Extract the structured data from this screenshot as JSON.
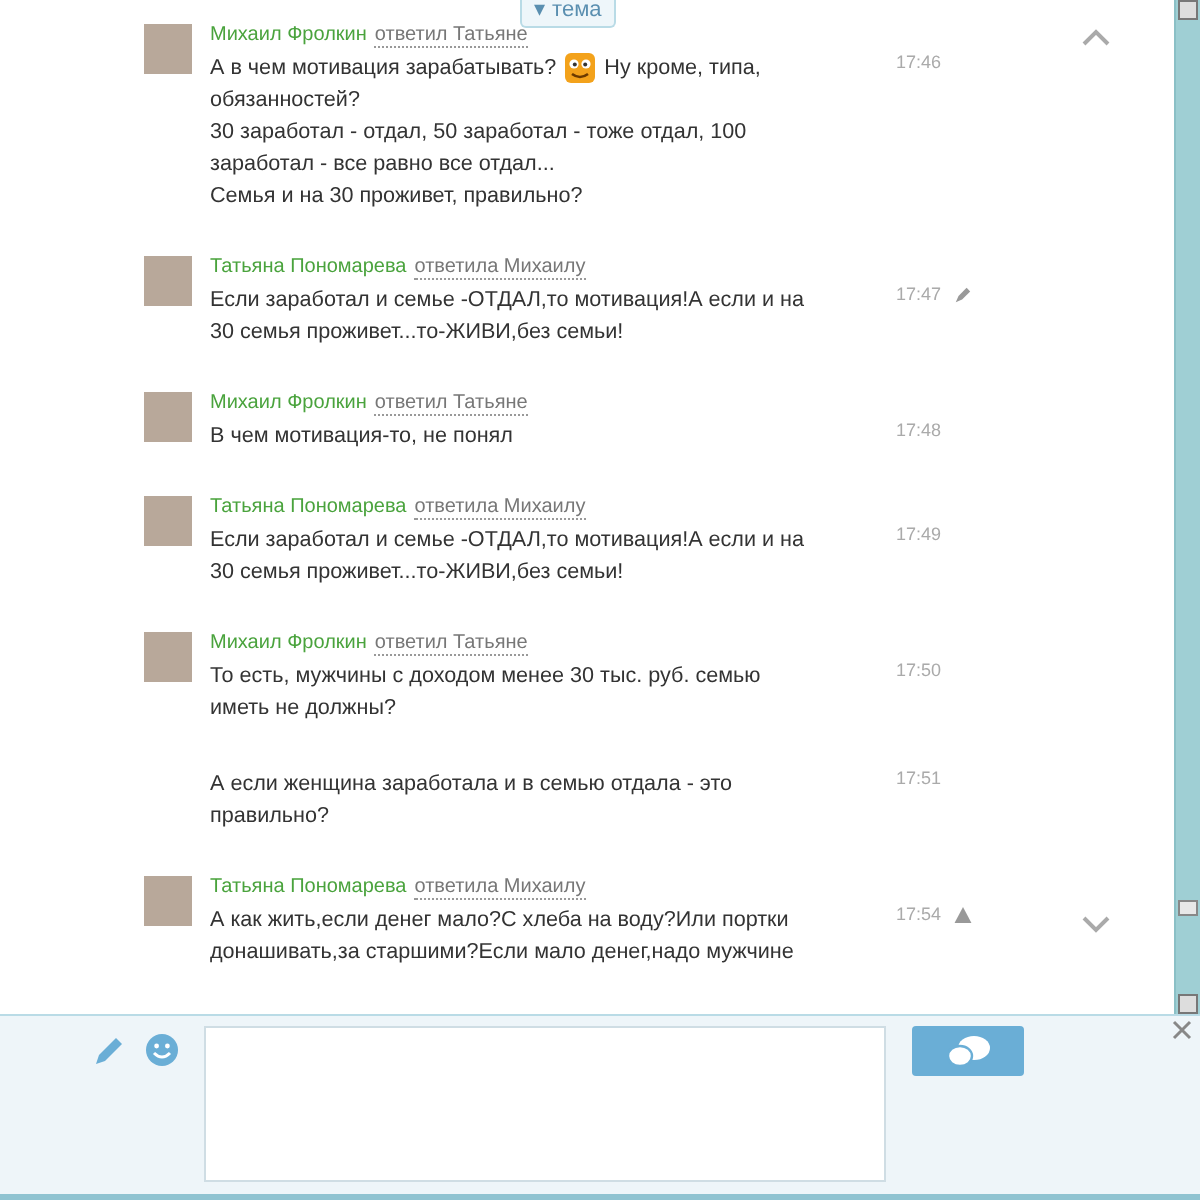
{
  "topic_tab": {
    "label": "▾ тема"
  },
  "messages": [
    {
      "author": "Михаил Фролкин",
      "reply_to": "ответил Татьяне",
      "avatar": true,
      "time": "17:46",
      "edited": false,
      "flagged": false,
      "lines": [
        [
          {
            "kind": "text",
            "text": "А в чем мотивация зарабатывать?"
          },
          {
            "kind": "emoji"
          },
          {
            "kind": "text",
            "text": "Ну кроме, типа,"
          }
        ],
        [
          {
            "kind": "text",
            "text": "обязанностей?"
          }
        ],
        [
          {
            "kind": "text",
            "text": "30 заработал - отдал, 50 заработал - тоже отдал, 100"
          }
        ],
        [
          {
            "kind": "text",
            "text": "заработал - все равно все отдал..."
          }
        ],
        [
          {
            "kind": "text",
            "text": "Семья и на 30 проживет, правильно?"
          }
        ]
      ]
    },
    {
      "author": "Татьяна Пономарева",
      "reply_to": "ответила Михаилу",
      "avatar": true,
      "time": "17:47",
      "edited": true,
      "flagged": false,
      "lines": [
        [
          {
            "kind": "text",
            "text": "Если заработал и семье -ОТДАЛ,то мотивация!А если и на"
          }
        ],
        [
          {
            "kind": "text",
            "text": "30 семья проживет...то-ЖИВИ,без семьи!"
          }
        ]
      ]
    },
    {
      "author": "Михаил Фролкин",
      "reply_to": "ответил Татьяне",
      "avatar": true,
      "time": "17:48",
      "edited": false,
      "flagged": false,
      "lines": [
        [
          {
            "kind": "text",
            "text": "В чем мотивация-то, не понял"
          }
        ]
      ]
    },
    {
      "author": "Татьяна Пономарева",
      "reply_to": "ответила Михаилу",
      "avatar": true,
      "time": "17:49",
      "edited": false,
      "flagged": false,
      "lines": [
        [
          {
            "kind": "text",
            "text": "Если заработал и семье -ОТДАЛ,то мотивация!А если и на"
          }
        ],
        [
          {
            "kind": "text",
            "text": "30 семья проживет...то-ЖИВИ,без семьи!"
          }
        ]
      ]
    },
    {
      "author": "Михаил Фролкин",
      "reply_to": "ответил Татьяне",
      "avatar": true,
      "time": "17:50",
      "edited": false,
      "flagged": false,
      "lines": [
        [
          {
            "kind": "text",
            "text": "То есть, мужчины с доходом менее 30 тыс. руб. семью"
          }
        ],
        [
          {
            "kind": "text",
            "text": "иметь не должны?"
          }
        ]
      ]
    },
    {
      "avatar": false,
      "time": "17:51",
      "edited": false,
      "flagged": false,
      "lines": [
        [
          {
            "kind": "text",
            "text": "А если женщина заработала и в семью отдала - это"
          }
        ],
        [
          {
            "kind": "text",
            "text": "правильно?"
          }
        ]
      ]
    },
    {
      "author": "Татьяна Пономарева",
      "reply_to": "ответила Михаилу",
      "avatar": true,
      "time": "17:54",
      "edited": false,
      "flagged": true,
      "lines": [
        [
          {
            "kind": "text",
            "text": "А как жить,если денег мало?С хлеба на воду?Или портки"
          }
        ],
        [
          {
            "kind": "text",
            "text": "донашивать,за старшими?Если мало денег,надо мужчине"
          }
        ]
      ]
    }
  ]
}
